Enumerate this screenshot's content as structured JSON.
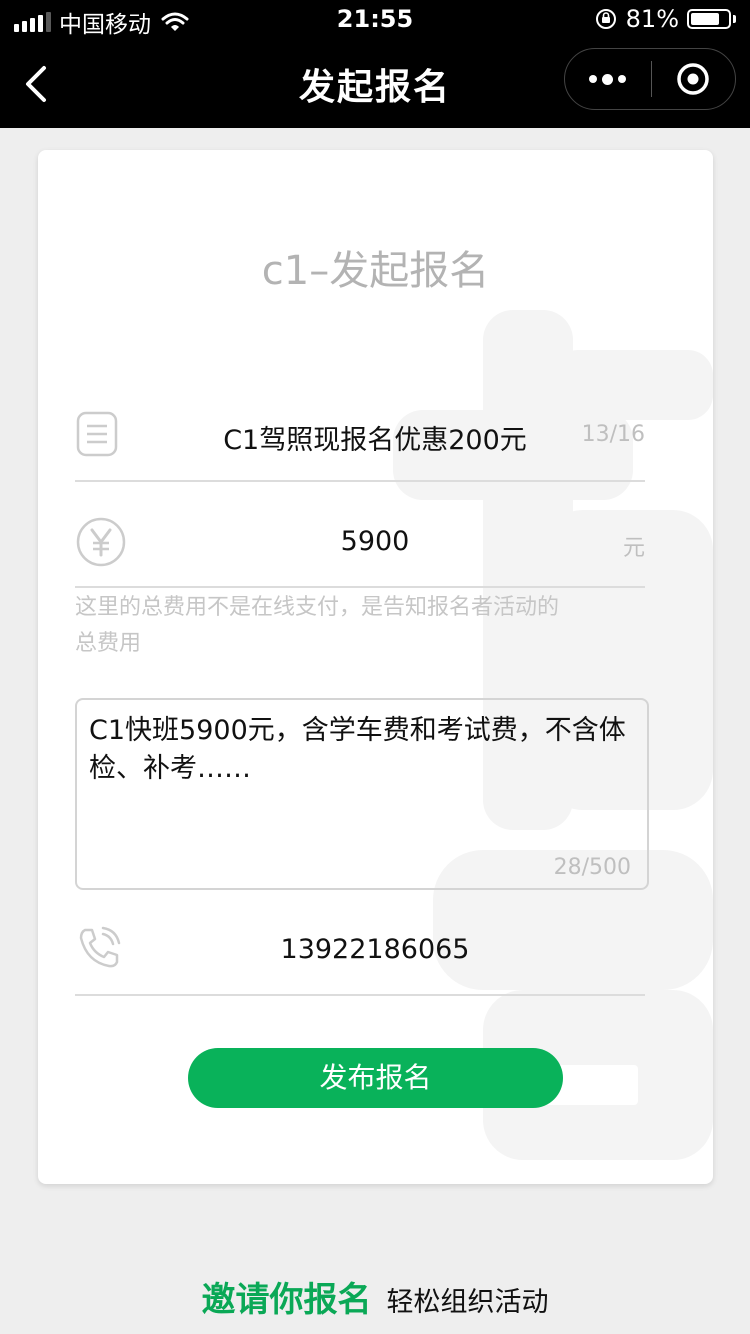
{
  "status_bar": {
    "carrier": "中国移动",
    "time": "21:55",
    "battery_percent": "81%",
    "battery_level": 0.81
  },
  "nav": {
    "title": "发起报名"
  },
  "form": {
    "heading": "c1–发起报名",
    "title_value": "C1驾照现报名优惠200元",
    "title_count": "13/16",
    "fee_value": "5900",
    "fee_unit": "元",
    "fee_hint": "这里的总费用不是在线支付，是告知报名者活动的总费用",
    "description_value": "C1快班5900元，含学车费和考试费，不含体检、补考……",
    "description_count": "28/500",
    "phone_value": "13922186065",
    "submit_label": "发布报名"
  },
  "footer": {
    "main": "邀请你报名",
    "sub": "轻松组织活动"
  },
  "colors": {
    "accent": "#09b25a",
    "footer_green": "#0aa856",
    "nav_background": "#000000",
    "page_background": "#eeeeee"
  },
  "icons": {
    "back": "chevron-left-icon",
    "more": "more-dots-icon",
    "close": "target-circle-icon",
    "title_field": "document-icon",
    "fee_field": "yen-icon",
    "phone_field": "phone-icon"
  }
}
